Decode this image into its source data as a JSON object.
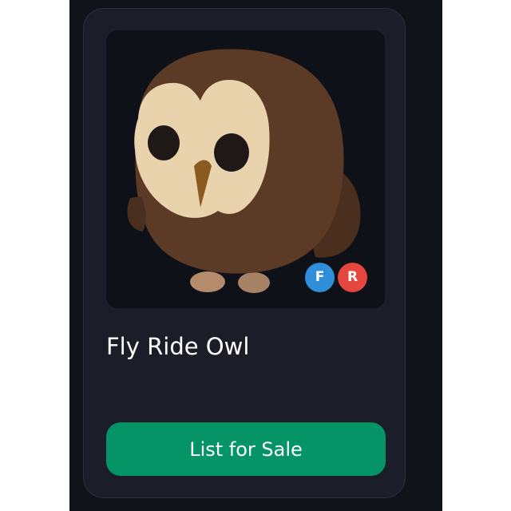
{
  "item": {
    "name": "Fly Ride Owl",
    "image_icon": "owl-pet-image",
    "badges": [
      {
        "letter": "F",
        "meaning": "fly",
        "color": "#2f8fdb"
      },
      {
        "letter": "R",
        "meaning": "ride",
        "color": "#e4473d"
      }
    ]
  },
  "actions": {
    "list_for_sale_label": "List for Sale"
  },
  "colors": {
    "page_panel": "#10131a",
    "card": "#1b1e29",
    "button": "#059465"
  }
}
